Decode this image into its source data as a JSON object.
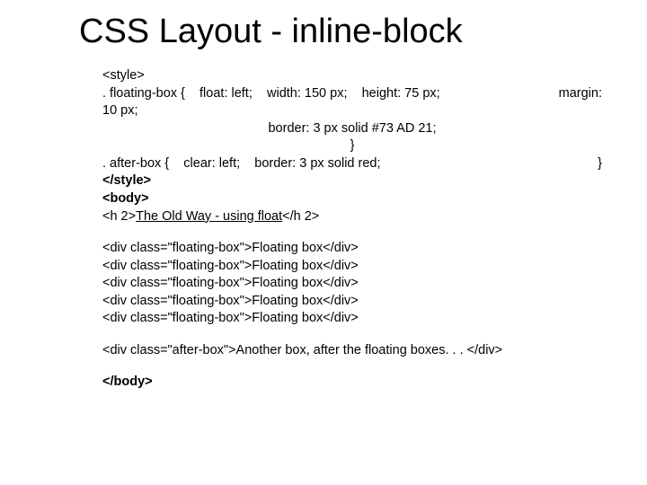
{
  "title": "CSS Layout - inline-block",
  "code": {
    "styleOpen": "<style>",
    "floatSel": ". floating-box {",
    "float": "float: left;",
    "width": "width: 150 px;",
    "height": "height: 75 px;",
    "margin": "margin:",
    "ten": "10 px;",
    "borderGreen": "border: 3 px solid #73 AD 21;",
    "closeBrace": "}",
    "afterSel": ". after-box {",
    "clear": "clear: left;",
    "borderRed": "border: 3 px solid red;",
    "closeBrace2": "}",
    "styleClose": "</style>",
    "bodyOpen": "<body>",
    "h2Open": "<h 2>",
    "h2Link": "The Old Way - using float",
    "h2Close": "</h 2>",
    "divFloat": "<div class=\"floating-box\">Floating box</div>",
    "divAfter": "<div class=\"after-box\">Another box, after the floating boxes. . . </div>",
    "bodyClose": "</body>"
  }
}
